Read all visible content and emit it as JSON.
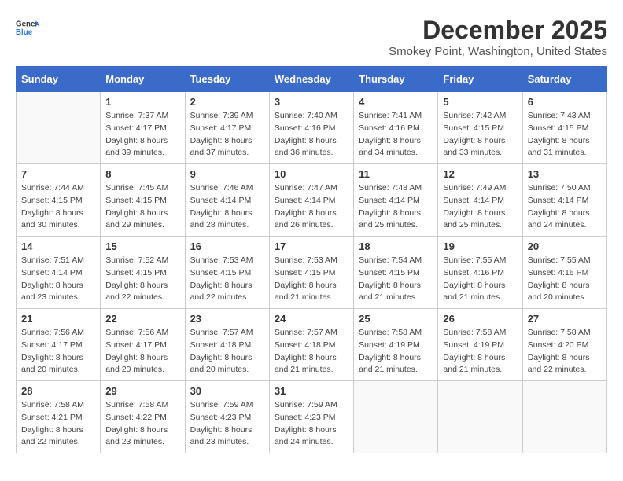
{
  "logo": {
    "general": "General",
    "blue": "Blue"
  },
  "title": "December 2025",
  "subtitle": "Smokey Point, Washington, United States",
  "days_of_week": [
    "Sunday",
    "Monday",
    "Tuesday",
    "Wednesday",
    "Thursday",
    "Friday",
    "Saturday"
  ],
  "weeks": [
    [
      {
        "day": "",
        "sunrise": "",
        "sunset": "",
        "daylight": ""
      },
      {
        "day": "1",
        "sunrise": "Sunrise: 7:37 AM",
        "sunset": "Sunset: 4:17 PM",
        "daylight": "Daylight: 8 hours and 39 minutes."
      },
      {
        "day": "2",
        "sunrise": "Sunrise: 7:39 AM",
        "sunset": "Sunset: 4:17 PM",
        "daylight": "Daylight: 8 hours and 37 minutes."
      },
      {
        "day": "3",
        "sunrise": "Sunrise: 7:40 AM",
        "sunset": "Sunset: 4:16 PM",
        "daylight": "Daylight: 8 hours and 36 minutes."
      },
      {
        "day": "4",
        "sunrise": "Sunrise: 7:41 AM",
        "sunset": "Sunset: 4:16 PM",
        "daylight": "Daylight: 8 hours and 34 minutes."
      },
      {
        "day": "5",
        "sunrise": "Sunrise: 7:42 AM",
        "sunset": "Sunset: 4:15 PM",
        "daylight": "Daylight: 8 hours and 33 minutes."
      },
      {
        "day": "6",
        "sunrise": "Sunrise: 7:43 AM",
        "sunset": "Sunset: 4:15 PM",
        "daylight": "Daylight: 8 hours and 31 minutes."
      }
    ],
    [
      {
        "day": "7",
        "sunrise": "Sunrise: 7:44 AM",
        "sunset": "Sunset: 4:15 PM",
        "daylight": "Daylight: 8 hours and 30 minutes."
      },
      {
        "day": "8",
        "sunrise": "Sunrise: 7:45 AM",
        "sunset": "Sunset: 4:15 PM",
        "daylight": "Daylight: 8 hours and 29 minutes."
      },
      {
        "day": "9",
        "sunrise": "Sunrise: 7:46 AM",
        "sunset": "Sunset: 4:14 PM",
        "daylight": "Daylight: 8 hours and 28 minutes."
      },
      {
        "day": "10",
        "sunrise": "Sunrise: 7:47 AM",
        "sunset": "Sunset: 4:14 PM",
        "daylight": "Daylight: 8 hours and 26 minutes."
      },
      {
        "day": "11",
        "sunrise": "Sunrise: 7:48 AM",
        "sunset": "Sunset: 4:14 PM",
        "daylight": "Daylight: 8 hours and 25 minutes."
      },
      {
        "day": "12",
        "sunrise": "Sunrise: 7:49 AM",
        "sunset": "Sunset: 4:14 PM",
        "daylight": "Daylight: 8 hours and 25 minutes."
      },
      {
        "day": "13",
        "sunrise": "Sunrise: 7:50 AM",
        "sunset": "Sunset: 4:14 PM",
        "daylight": "Daylight: 8 hours and 24 minutes."
      }
    ],
    [
      {
        "day": "14",
        "sunrise": "Sunrise: 7:51 AM",
        "sunset": "Sunset: 4:14 PM",
        "daylight": "Daylight: 8 hours and 23 minutes."
      },
      {
        "day": "15",
        "sunrise": "Sunrise: 7:52 AM",
        "sunset": "Sunset: 4:15 PM",
        "daylight": "Daylight: 8 hours and 22 minutes."
      },
      {
        "day": "16",
        "sunrise": "Sunrise: 7:53 AM",
        "sunset": "Sunset: 4:15 PM",
        "daylight": "Daylight: 8 hours and 22 minutes."
      },
      {
        "day": "17",
        "sunrise": "Sunrise: 7:53 AM",
        "sunset": "Sunset: 4:15 PM",
        "daylight": "Daylight: 8 hours and 21 minutes."
      },
      {
        "day": "18",
        "sunrise": "Sunrise: 7:54 AM",
        "sunset": "Sunset: 4:15 PM",
        "daylight": "Daylight: 8 hours and 21 minutes."
      },
      {
        "day": "19",
        "sunrise": "Sunrise: 7:55 AM",
        "sunset": "Sunset: 4:16 PM",
        "daylight": "Daylight: 8 hours and 21 minutes."
      },
      {
        "day": "20",
        "sunrise": "Sunrise: 7:55 AM",
        "sunset": "Sunset: 4:16 PM",
        "daylight": "Daylight: 8 hours and 20 minutes."
      }
    ],
    [
      {
        "day": "21",
        "sunrise": "Sunrise: 7:56 AM",
        "sunset": "Sunset: 4:17 PM",
        "daylight": "Daylight: 8 hours and 20 minutes."
      },
      {
        "day": "22",
        "sunrise": "Sunrise: 7:56 AM",
        "sunset": "Sunset: 4:17 PM",
        "daylight": "Daylight: 8 hours and 20 minutes."
      },
      {
        "day": "23",
        "sunrise": "Sunrise: 7:57 AM",
        "sunset": "Sunset: 4:18 PM",
        "daylight": "Daylight: 8 hours and 20 minutes."
      },
      {
        "day": "24",
        "sunrise": "Sunrise: 7:57 AM",
        "sunset": "Sunset: 4:18 PM",
        "daylight": "Daylight: 8 hours and 21 minutes."
      },
      {
        "day": "25",
        "sunrise": "Sunrise: 7:58 AM",
        "sunset": "Sunset: 4:19 PM",
        "daylight": "Daylight: 8 hours and 21 minutes."
      },
      {
        "day": "26",
        "sunrise": "Sunrise: 7:58 AM",
        "sunset": "Sunset: 4:19 PM",
        "daylight": "Daylight: 8 hours and 21 minutes."
      },
      {
        "day": "27",
        "sunrise": "Sunrise: 7:58 AM",
        "sunset": "Sunset: 4:20 PM",
        "daylight": "Daylight: 8 hours and 22 minutes."
      }
    ],
    [
      {
        "day": "28",
        "sunrise": "Sunrise: 7:58 AM",
        "sunset": "Sunset: 4:21 PM",
        "daylight": "Daylight: 8 hours and 22 minutes."
      },
      {
        "day": "29",
        "sunrise": "Sunrise: 7:58 AM",
        "sunset": "Sunset: 4:22 PM",
        "daylight": "Daylight: 8 hours and 23 minutes."
      },
      {
        "day": "30",
        "sunrise": "Sunrise: 7:59 AM",
        "sunset": "Sunset: 4:23 PM",
        "daylight": "Daylight: 8 hours and 23 minutes."
      },
      {
        "day": "31",
        "sunrise": "Sunrise: 7:59 AM",
        "sunset": "Sunset: 4:23 PM",
        "daylight": "Daylight: 8 hours and 24 minutes."
      },
      {
        "day": "",
        "sunrise": "",
        "sunset": "",
        "daylight": ""
      },
      {
        "day": "",
        "sunrise": "",
        "sunset": "",
        "daylight": ""
      },
      {
        "day": "",
        "sunrise": "",
        "sunset": "",
        "daylight": ""
      }
    ]
  ]
}
